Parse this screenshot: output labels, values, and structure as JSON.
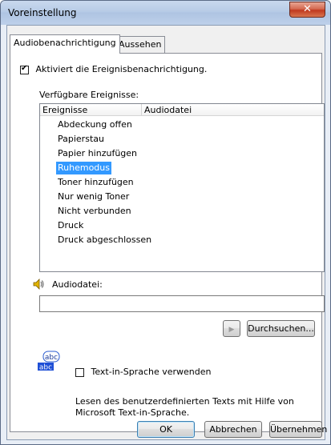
{
  "window": {
    "title": "Voreinstellung"
  },
  "tabs": [
    {
      "label": "Audiobenachrichtigung",
      "active": true
    },
    {
      "label": "Aussehen",
      "active": false
    }
  ],
  "enable_checkbox": {
    "label": "Aktiviert die Ereignisbenachrichtigung.",
    "checked": true
  },
  "events": {
    "group_label": "Verfügbare Ereignisse:",
    "columns": [
      "Ereignisse",
      "Audiodatei"
    ],
    "items": [
      "Abdeckung offen",
      "Papierstau",
      "Papier hinzufügen",
      "Ruhemodus",
      "Toner hinzufügen",
      "Nur wenig Toner",
      "Nicht verbunden",
      "Druck",
      "Druck abgeschlossen"
    ],
    "selected_index": 3
  },
  "audiofile": {
    "label": "Audiodatei:",
    "value": ""
  },
  "browse_button": "Durchsuchen...",
  "tts": {
    "icon_text_top": "abc",
    "icon_text_bottom": "abc",
    "checkbox_label": "Text-in-Sprache verwenden",
    "checked": false,
    "description": "Lesen des benutzerdefinierten Texts mit Hilfe von Microsoft Text-in-Sprache."
  },
  "footer": {
    "ok": "OK",
    "cancel": "Abbrechen",
    "apply": "Übernehmen"
  },
  "colors": {
    "selection": "#3399ff",
    "close": "#c0391f"
  }
}
